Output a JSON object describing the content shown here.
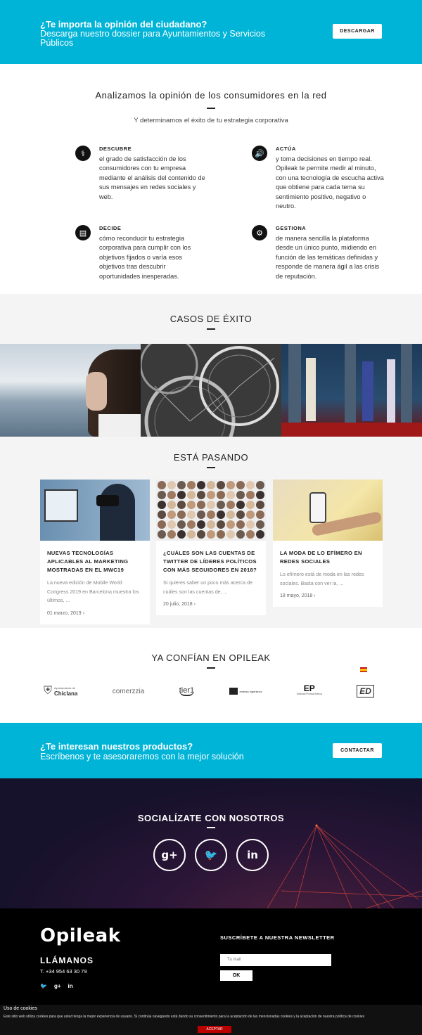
{
  "top_cta": {
    "line1": "¿Te importa la opinión del ciudadano?",
    "line2": "Descarga nuestro dossier para Ayuntamientos y Servicios Públicos",
    "button": "DESCARGAR"
  },
  "intro": {
    "title": "Analizamos la opinión de los consumidores en la red",
    "subtitle": "Y determinamos el éxito de tu estrategia corporativa",
    "features": [
      {
        "icon": "stethoscope-icon",
        "glyph": "⚕",
        "head": "DESCUBRE",
        "body": "el grado de satisfacción de los consumidores con tu empresa mediante el análisis del contenido de sus mensajes en redes sociales y web."
      },
      {
        "icon": "speaker-icon",
        "glyph": "🔊",
        "head": "ACTÚA",
        "body": "y toma decisiones en tiempo real. Opileak te permite medir al minuto, con una tecnología de escucha activa que obtiene para cada tema su sentimiento positivo, negativo o neutro."
      },
      {
        "icon": "document-icon",
        "glyph": "▤",
        "head": "DECIDE",
        "body": "cómo reconducir tu estrategia corporativa para cumplir con los objetivos fijados o varía esos objetivos tras descubrir oportunidades inesperadas."
      },
      {
        "icon": "gears-icon",
        "glyph": "⚙",
        "head": "GESTIONA",
        "body": "de manera sencilla la plataforma desde un único punto, midiendo en función de las temáticas definidas y responde de manera ágil a las crisis de reputación."
      }
    ]
  },
  "casos": {
    "title": "CASOS DE ÉXITO"
  },
  "pasando": {
    "title": "ESTÁ PASANDO",
    "posts": [
      {
        "title": "NUEVAS TECNOLOGÍAS APLICABLES AL MARKETING MOSTRADAS EN EL MWC19",
        "excerpt": "La nueva edición de Mobile World Congress 2019 en Barcelona muestra los últimos, ...",
        "date": "01 marzo, 2019",
        "arrow": "›"
      },
      {
        "title": "¿CUÁLES SON LAS CUENTAS DE TWITTER DE LÍDERES POLÍTICOS CON MÁS SEGUIDORES EN 2018?",
        "excerpt": "Si quieres saber un poco más acerca de cuáles son las cuentas de, ...",
        "date": "20 julio, 2018",
        "arrow": "›"
      },
      {
        "title": "LA MODA DE LO EFÍMERO EN REDES SOCIALES",
        "excerpt": "Lo efímero está de moda en las redes sociales. Basta con ver la, ...",
        "date": "18 mayo, 2018",
        "arrow": "›"
      }
    ]
  },
  "confian": {
    "title": "YA CONFÍAN EN OPILEAK",
    "logos": [
      {
        "name": "Chiclana",
        "sub": "Ayuntamiento de"
      },
      {
        "name": "comerzzia",
        "sub": ""
      },
      {
        "name": "tier1",
        "sub": ""
      },
      {
        "name": "",
        "sub": "endesa ingeniería"
      },
      {
        "name": "",
        "sub": "Editorial Prensa Ibérica"
      },
      {
        "name": "ED",
        "sub": ""
      }
    ]
  },
  "bottom_cta": {
    "line1": "¿Te interesan nuestros productos?",
    "line2": "Escríbenos y te asesoraremos con la mejor solución",
    "button": "CONTACTAR"
  },
  "social": {
    "title": "SOCIALÍZATE CON NOSOTROS",
    "items": [
      {
        "icon": "google-plus-icon",
        "glyph": "g+"
      },
      {
        "icon": "twitter-icon",
        "glyph": "🐦"
      },
      {
        "icon": "linkedin-icon",
        "glyph": "in"
      }
    ]
  },
  "footer": {
    "brand": "Opileak",
    "call_title": "LLÁMANOS",
    "phone": "T. +34 954 63 30 79",
    "social_glyphs": [
      "🐦",
      "g+",
      "in"
    ],
    "newsletter_title": "SUSCRÍBETE A NUESTRA NEWSLETTER",
    "email_placeholder": "Tu mail",
    "ok_button": "OK"
  },
  "cookies": {
    "title": "Uso de cookies",
    "text": "Este sitio web utiliza cookies para que usted tenga la mejor experiencia de usuario. Si continúa navegando está dando su consentimiento para la aceptación de las mencionadas cookies y la aceptación de nuestra política de cookies",
    "button": "ACEPTAR"
  },
  "colors": {
    "accent": "#00b4d8",
    "dark": "#000000",
    "cookie_button": "#bb0000"
  }
}
